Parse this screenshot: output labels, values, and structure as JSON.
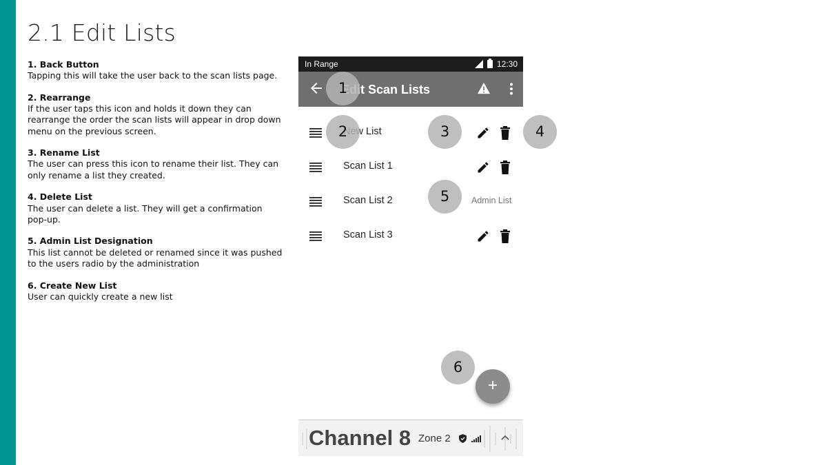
{
  "slide": {
    "title": "2.1 Edit Lists",
    "notes": [
      {
        "title": "1. Back Button",
        "body": "Tapping this will take the user back to the scan lists page."
      },
      {
        "title": "2. Rearrange",
        "body": "If the user taps this icon and holds it down they can rearrange the order the scan lists will appear in drop down menu on the previous screen."
      },
      {
        "title": "3. Rename List",
        "body": "The user can press this icon to rename their list. They can only rename a list they created."
      },
      {
        "title": "4. Delete List",
        "body": "The user can delete a list. They will get a confirmation pop-up."
      },
      {
        "title": "5. Admin List Designation",
        "body": "This list cannot be deleted or renamed since it was pushed to the users radio by the administration"
      },
      {
        "title": "6. Create New List",
        "body": "User can quickly create a new list"
      }
    ]
  },
  "phone": {
    "status": {
      "left": "In Range",
      "time": "12:30"
    },
    "app_bar": {
      "title": "Edit Scan Lists",
      "back_icon": "arrow-left-icon",
      "warning_icon": "warning-icon",
      "more_icon": "more-vert-icon"
    },
    "lists": [
      {
        "label": "New List",
        "editable": true
      },
      {
        "label": "Scan List 1",
        "editable": true
      },
      {
        "label": "Scan List 2",
        "editable": false,
        "tag": "Admin List"
      },
      {
        "label": "Scan List 3",
        "editable": true
      }
    ],
    "fab": {
      "label": "+"
    },
    "bottom_bar": {
      "channel": "Channel 8",
      "zone": "Zone 2"
    }
  },
  "markers": [
    "1",
    "2",
    "3",
    "4",
    "5",
    "6"
  ],
  "colors": {
    "accent": "#00968f",
    "app_bar": "#6f6f6f",
    "fab": "#8c8c8c",
    "marker": "#b4b4b4"
  }
}
